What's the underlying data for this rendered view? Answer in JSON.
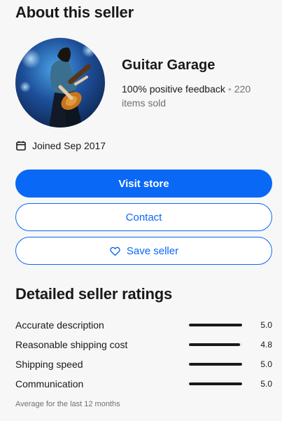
{
  "about": {
    "title": "About this seller"
  },
  "seller": {
    "name": "Guitar Garage",
    "feedback": "100% positive feedback",
    "items_sold": "220 items sold",
    "joined": "Joined Sep 2017"
  },
  "actions": {
    "visit_store": "Visit store",
    "contact": "Contact",
    "save_seller": "Save seller"
  },
  "icons": {
    "calendar": "calendar-icon",
    "heart": "heart-icon"
  },
  "colors": {
    "primary": "#0968f6",
    "text": "#191919",
    "muted": "#707070",
    "background": "#f7f7f7"
  },
  "ratings": {
    "title": "Detailed seller ratings",
    "scale_max": 5,
    "items": [
      {
        "label": "Accurate description",
        "value": "5.0",
        "score": 5.0
      },
      {
        "label": "Reasonable shipping cost",
        "value": "4.8",
        "score": 4.8
      },
      {
        "label": "Shipping speed",
        "value": "5.0",
        "score": 5.0
      },
      {
        "label": "Communication",
        "value": "5.0",
        "score": 5.0
      }
    ],
    "note": "Average for the last 12 months"
  }
}
